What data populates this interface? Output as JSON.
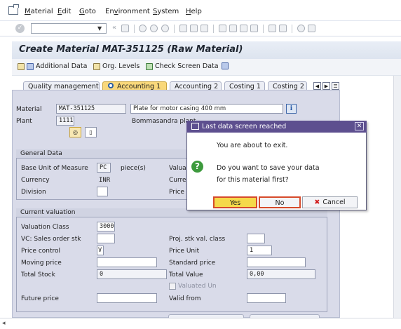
{
  "menu": {
    "items": [
      "Material",
      "Edit",
      "Goto",
      "Environment",
      "System",
      "Help"
    ],
    "underline": [
      "M",
      "E",
      "G",
      "v",
      "S",
      "H"
    ]
  },
  "page": {
    "title": "Create Material MAT-351125 (Raw Material)"
  },
  "app_toolbar": {
    "additional_data": "Additional Data",
    "org_levels": "Org. Levels",
    "check_screen_data": "Check Screen Data"
  },
  "tabs": [
    "Quality management",
    "Accounting 1",
    "Accounting 2",
    "Costing 1",
    "Costing 2"
  ],
  "active_tab": "Accounting 1",
  "header": {
    "material_label": "Material",
    "material_value": "MAT-351125",
    "material_desc": "Plate for motor casing 400 mm",
    "plant_label": "Plant",
    "plant_value": "1111",
    "plant_desc": "Bommasandra plant"
  },
  "general_data": {
    "title": "General Data",
    "base_uom_label": "Base Unit of Measure",
    "base_uom_value": "PC",
    "base_uom_text": "piece(s)",
    "currency_label": "Currency",
    "currency_value": "INR",
    "division_label": "Division",
    "valuation_label_partial": "Valuati",
    "current_label_partial": "Current",
    "price_label_partial": "Price d"
  },
  "current_valuation": {
    "title": "Current valuation",
    "valuation_class_label": "Valuation Class",
    "valuation_class_value": "3000",
    "vc_sales_label": "VC: Sales order stk",
    "proj_stk_label": "Proj. stk val. class",
    "price_control_label": "Price control",
    "price_control_value": "V",
    "price_unit_label": "Price Unit",
    "price_unit_value": "1",
    "moving_price_label": "Moving price",
    "standard_price_label": "Standard price",
    "total_stock_label": "Total Stock",
    "total_stock_value": "0",
    "total_value_label": "Total Value",
    "total_value_value": "0,00",
    "valuated_un_label": "Valuated Un",
    "future_price_label": "Future price",
    "valid_from_label": "Valid from"
  },
  "dialog": {
    "title": "Last data screen reached",
    "line1": "You are about to exit.",
    "line2": "Do you want to save your data",
    "line3": "for this material first?",
    "yes_label": "Yes",
    "no_label": "No",
    "cancel_label": "Cancel"
  },
  "colors": {
    "dialog_title_bg": "#5d4f8f",
    "active_tab_bg": "#f9d87a",
    "primary_button_bg": "#f5d94a",
    "panel_bg": "#d9dbe9"
  }
}
